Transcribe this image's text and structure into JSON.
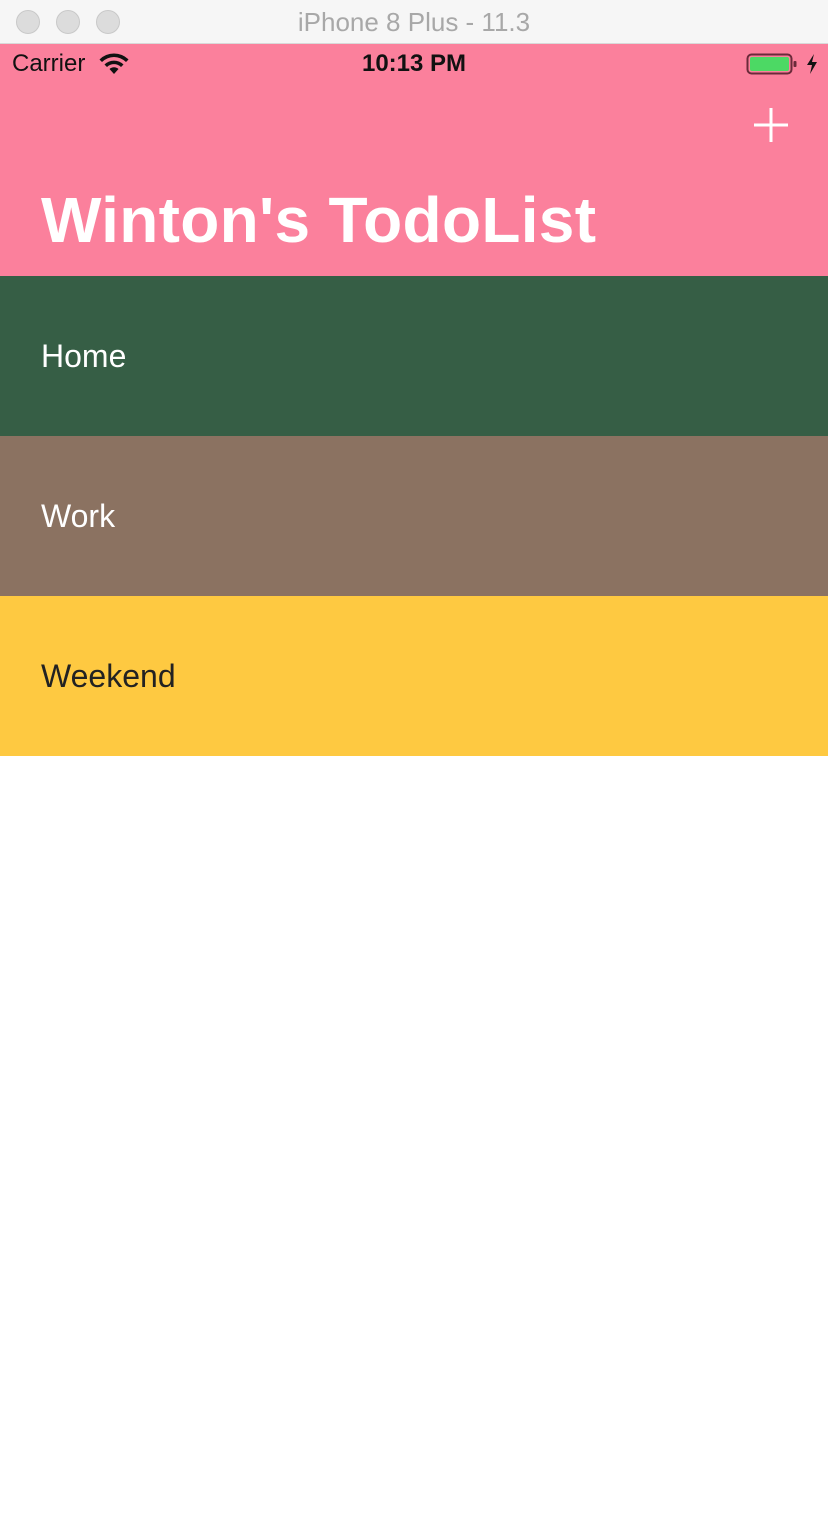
{
  "window": {
    "title": "iPhone 8 Plus - 11.3"
  },
  "status_bar": {
    "carrier": "Carrier",
    "time": "10:13 PM",
    "wifi_icon": "wifi-icon",
    "battery_icon": "battery-icon",
    "charging_icon": "bolt-icon",
    "battery_color": "#4cd964"
  },
  "nav": {
    "title": "Winton's TodoList",
    "add_icon": "plus-icon",
    "background": "#fb809c"
  },
  "categories": [
    {
      "label": "Home",
      "color": "#365e45",
      "text_color": "#ffffff"
    },
    {
      "label": "Work",
      "color": "#8b7261",
      "text_color": "#ffffff"
    },
    {
      "label": "Weekend",
      "color": "#fec941",
      "text_color": "#222222"
    }
  ]
}
